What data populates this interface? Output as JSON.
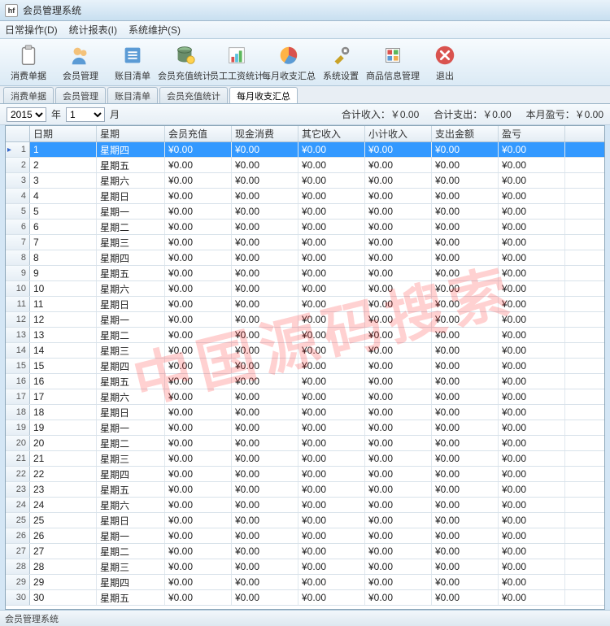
{
  "window": {
    "title": "会员管理系统",
    "logo": "hf"
  },
  "menu": {
    "daily": "日常操作(D)",
    "report": "统计报表(I)",
    "maint": "系统维护(S)"
  },
  "toolbar": [
    {
      "name": "consume-receipt",
      "label": "消费单据",
      "icon": "clipboard"
    },
    {
      "name": "member-manage",
      "label": "会员管理",
      "icon": "people"
    },
    {
      "name": "ledger-list",
      "label": "账目清单",
      "icon": "list"
    },
    {
      "name": "recharge-stats",
      "label": "会员充值统计",
      "icon": "db"
    },
    {
      "name": "salary-stats",
      "label": "员工工资统计",
      "icon": "chart"
    },
    {
      "name": "monthly-summary",
      "label": "每月收支汇总",
      "icon": "pie"
    },
    {
      "name": "sys-settings",
      "label": "系统设置",
      "icon": "tools"
    },
    {
      "name": "product-info",
      "label": "商品信息管理",
      "icon": "grid"
    },
    {
      "name": "exit",
      "label": "退出",
      "icon": "exit"
    }
  ],
  "tabs": [
    {
      "name": "tab-consume",
      "label": "消费单据",
      "active": false
    },
    {
      "name": "tab-member",
      "label": "会员管理",
      "active": false
    },
    {
      "name": "tab-ledger",
      "label": "账目清单",
      "active": false
    },
    {
      "name": "tab-recharge",
      "label": "会员充值统计",
      "active": false
    },
    {
      "name": "tab-monthly",
      "label": "每月收支汇总",
      "active": true
    }
  ],
  "filter": {
    "year": "2015",
    "year_lbl": "年",
    "month": "1",
    "month_lbl": "月",
    "sum_in_lbl": "合计收入：",
    "sum_in": "￥0.00",
    "sum_out_lbl": "合计支出：",
    "sum_out": "￥0.00",
    "profit_lbl": "本月盈亏：",
    "profit": "￥0.00"
  },
  "columns": [
    "日期",
    "星期",
    "会员充值",
    "现金消费",
    "其它收入",
    "小计收入",
    "支出金额",
    "盈亏"
  ],
  "weekdays": [
    "星期四",
    "星期五",
    "星期六",
    "星期日",
    "星期一",
    "星期二",
    "星期三",
    "星期四",
    "星期五",
    "星期六",
    "星期日",
    "星期一",
    "星期二",
    "星期三",
    "星期四",
    "星期五",
    "星期六",
    "星期日",
    "星期一",
    "星期二",
    "星期三",
    "星期四",
    "星期五",
    "星期六",
    "星期日",
    "星期一",
    "星期二",
    "星期三",
    "星期四",
    "星期五"
  ],
  "cellval": "¥0.00",
  "status": "会员管理系统",
  "watermark": "中国源码搜索"
}
